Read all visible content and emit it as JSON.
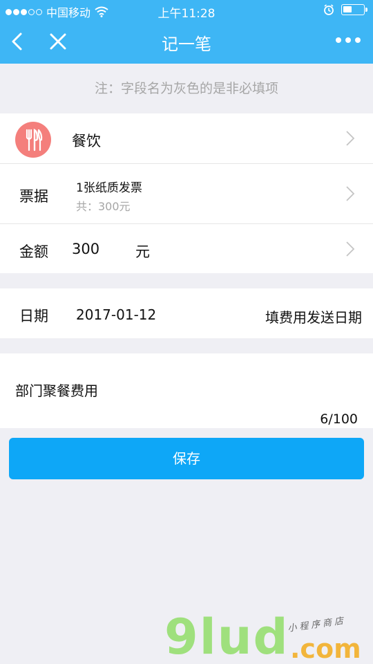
{
  "status_bar": {
    "carrier": "中国移动",
    "time": "上午11:28",
    "signal_icon": "signal-dots-icon",
    "wifi_icon": "wifi-icon",
    "alarm_icon": "alarm-icon",
    "battery_level": 0.45
  },
  "nav": {
    "title": "记一笔",
    "back_icon": "chevron-left-icon",
    "close_icon": "close-icon",
    "more_icon": "more-dots-icon"
  },
  "note": "注：字段名为灰色的是非必填项",
  "category": {
    "icon": "fork-knife-icon",
    "label": "餐饮"
  },
  "invoice": {
    "label": "票据",
    "count_text": "1张纸质发票",
    "total_text": "共：300元"
  },
  "amount": {
    "label": "金额",
    "value": "300",
    "unit": "元"
  },
  "date": {
    "label": "日期",
    "value": "2017-01-12",
    "hint": "填费用发送日期"
  },
  "remark": {
    "text": "部门聚餐费用",
    "counter": "6/100"
  },
  "save_button": "保存",
  "watermark": {
    "logo": "9lud",
    "domain": ".com",
    "tagline": "小程序商店"
  },
  "colors": {
    "primary": "#3eb6f5",
    "button": "#0ea7f7",
    "category_icon_bg": "#f47f7c",
    "muted": "#a6a6a6",
    "page_bg": "#efeff4"
  }
}
